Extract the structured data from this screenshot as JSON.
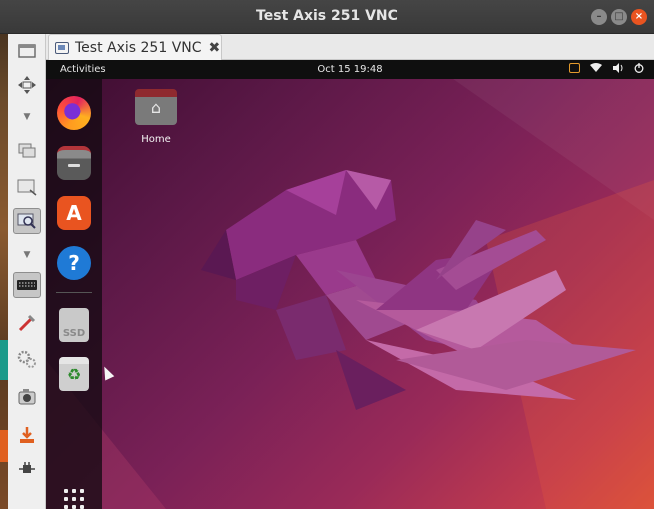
{
  "window": {
    "title": "Test Axis 251 VNC",
    "buttons": {
      "minimize": "–",
      "maximize": "□",
      "close": "×"
    }
  },
  "tab": {
    "label": "Test Axis 251 VNC",
    "close": "✖",
    "icon": "monitor-icon"
  },
  "toolbar": {
    "items": [
      "new-window-icon",
      "fullscreen-icon",
      "chevron-down-icon",
      "windows-icon",
      "scale-icon",
      "zoom-icon",
      "chevron-down-icon",
      "keyboard-icon",
      "tools-icon",
      "settings-icon",
      "camera-icon",
      "transfer-icon",
      "plug-icon"
    ]
  },
  "remote": {
    "topbar": {
      "activities": "Activities",
      "clock": "Oct 15  19:48"
    },
    "dock": {
      "items": [
        "firefox-icon",
        "files-icon",
        "app-center-icon",
        "help-icon",
        "ssd-drive-icon",
        "trash-icon",
        "app-grid-icon"
      ],
      "ssd_label": "SSD",
      "appcenter_glyph": "A",
      "help_glyph": "?"
    },
    "desktop": {
      "home_label": "Home"
    }
  },
  "colors": {
    "accent": "#e95420",
    "topbar": "#0f0f0f",
    "wallpaper_start": "#3a0c2e",
    "wallpaper_end": "#d9503a"
  }
}
